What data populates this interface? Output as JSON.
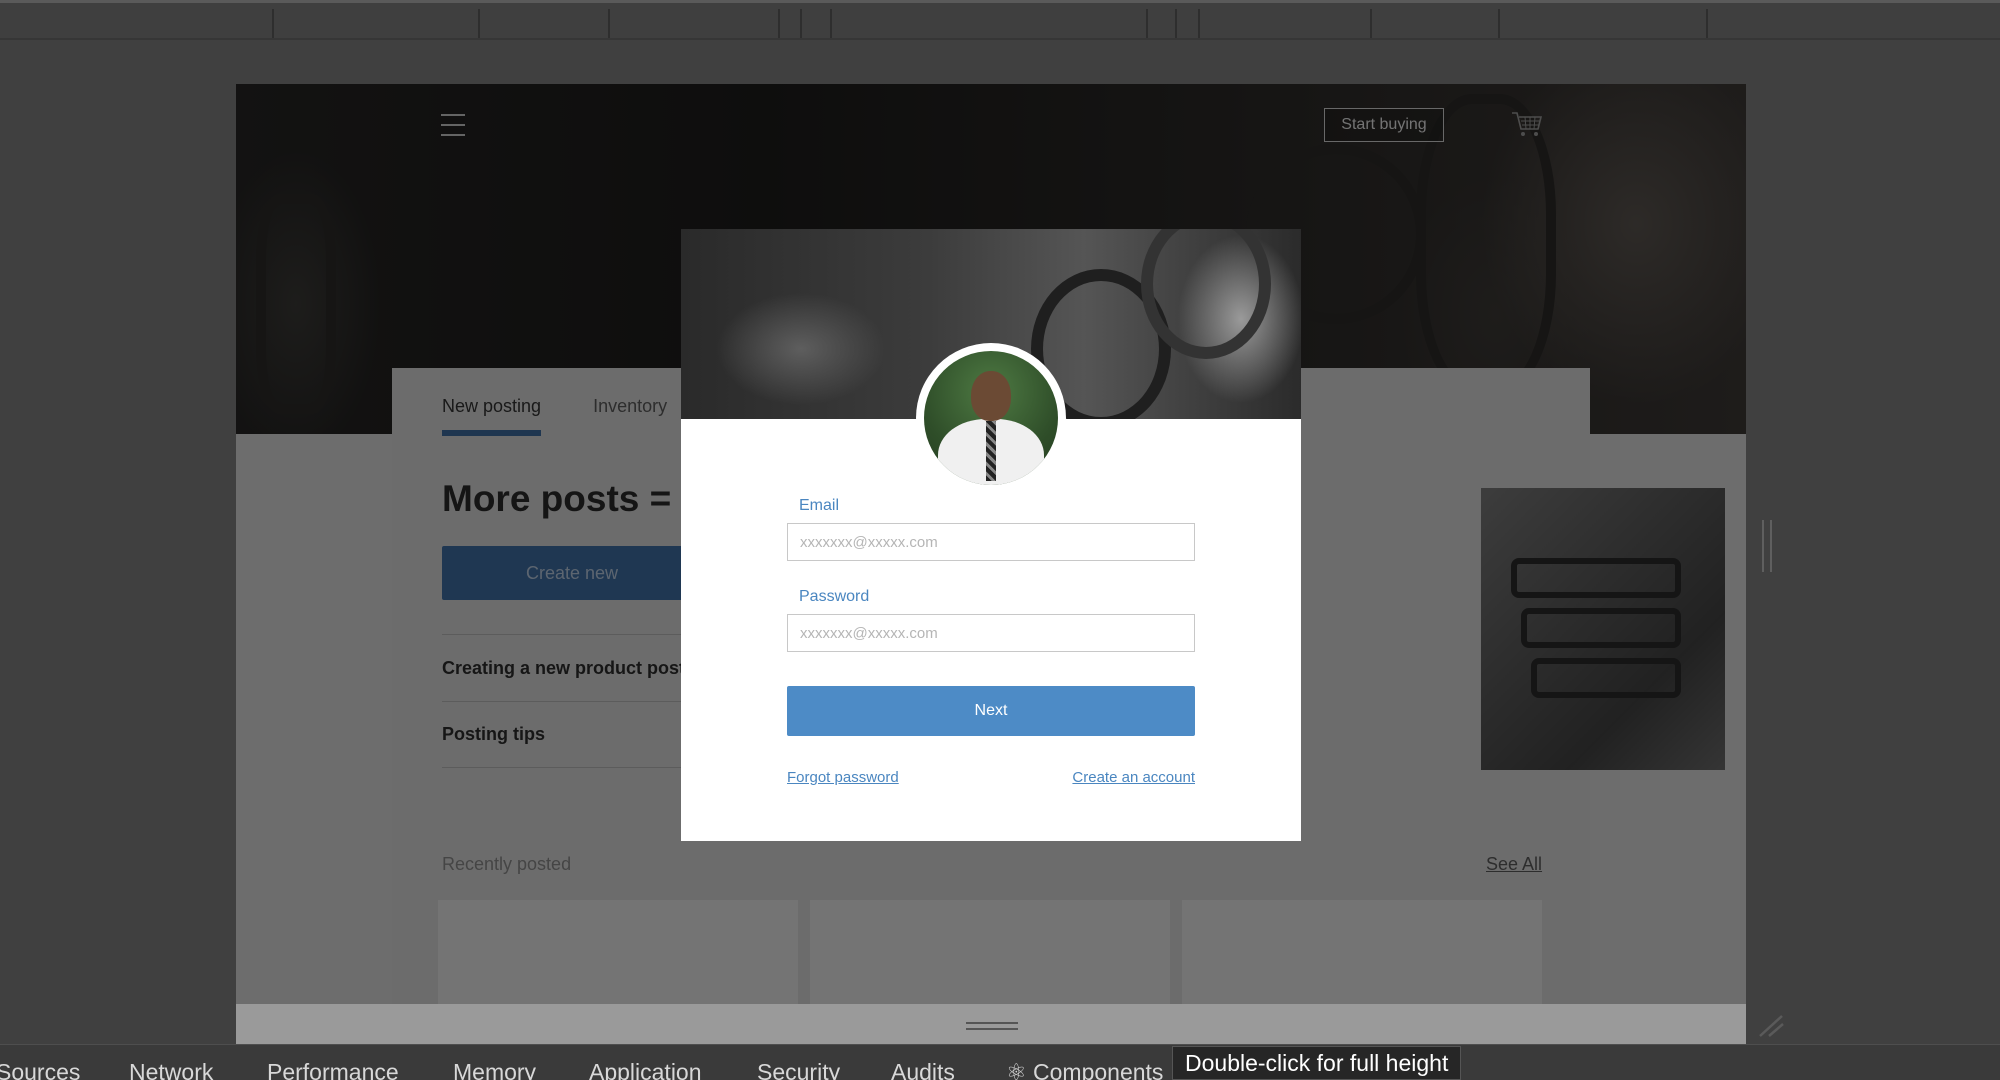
{
  "header": {
    "start_buying_label": "Start buying"
  },
  "tabs": [
    {
      "label": "New posting"
    },
    {
      "label": "Inventory"
    }
  ],
  "main": {
    "headline": "More posts = M",
    "create_button": "Create new",
    "links": [
      {
        "label": "Creating a new product post"
      },
      {
        "label": "Posting tips"
      }
    ],
    "recent_label": "Recently posted",
    "see_all": "See All"
  },
  "modal": {
    "email_label": "Email",
    "email_placeholder": "xxxxxxx@xxxxx.com",
    "password_label": "Password",
    "password_placeholder": "xxxxxxx@xxxxx.com",
    "next_button": "Next",
    "forgot_password": "Forgot password",
    "create_account": "Create an account"
  },
  "devtools": {
    "tabs": [
      "Sources",
      "Network",
      "Performance",
      "Memory",
      "Application",
      "Security",
      "Audits",
      "⚛ Components"
    ],
    "tooltip": "Double-click for full height"
  },
  "colors": {
    "accent": "#4d8bc6",
    "tab_underline": "#3e6da0",
    "link": "#4a86c0"
  },
  "icons": [
    "menu-icon",
    "cart-icon",
    "resize-corner-icon",
    "drawer-handle-icon"
  ]
}
